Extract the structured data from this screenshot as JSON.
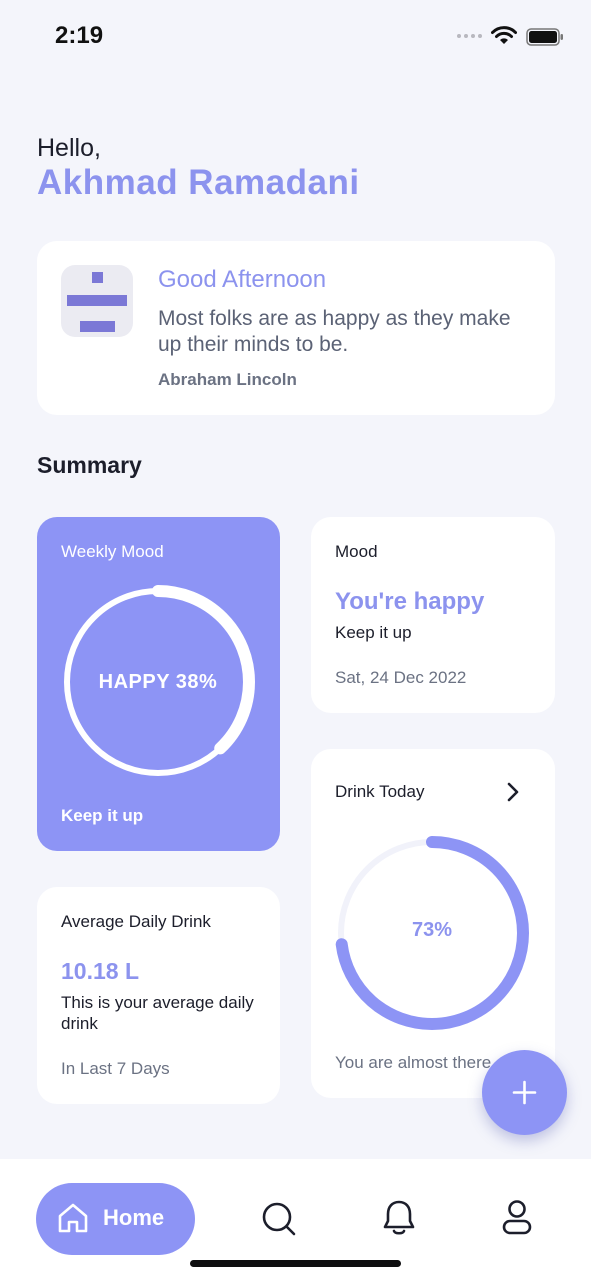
{
  "status_bar": {
    "time": "2:19"
  },
  "header": {
    "greeting": "Hello,",
    "username": "Akhmad Ramadani"
  },
  "quote_card": {
    "title": "Good Afternoon",
    "quote": "Most folks are as happy as they make up their minds to be.",
    "author": "Abraham Lincoln",
    "icon": "quote-glyph-icon"
  },
  "summary": {
    "title": "Summary",
    "weekly_mood": {
      "label": "Weekly Mood",
      "center_text": "HAPPY 38%",
      "percent": 38,
      "footer": "Keep it up"
    },
    "mood": {
      "label": "Mood",
      "value": "You're happy",
      "subtext": "Keep it up",
      "date": "Sat, 24 Dec 2022"
    },
    "drink_today": {
      "label": "Drink Today",
      "center_text": "73%",
      "percent": 73,
      "footer": "You are almost there"
    },
    "average_drink": {
      "label": "Average Daily Drink",
      "value": "10.18 L",
      "description": "This is your average daily drink",
      "footer": "In Last 7 Days"
    }
  },
  "bottom_nav": {
    "items": [
      {
        "label": "Home",
        "icon": "home-icon",
        "active": true
      },
      {
        "label": "",
        "icon": "search-icon",
        "active": false
      },
      {
        "label": "",
        "icon": "bell-icon",
        "active": false
      },
      {
        "label": "",
        "icon": "profile-icon",
        "active": false
      }
    ]
  },
  "colors": {
    "accent": "#8c93ee",
    "card_accent": "#8d94f5",
    "background": "#f4f5fb"
  }
}
